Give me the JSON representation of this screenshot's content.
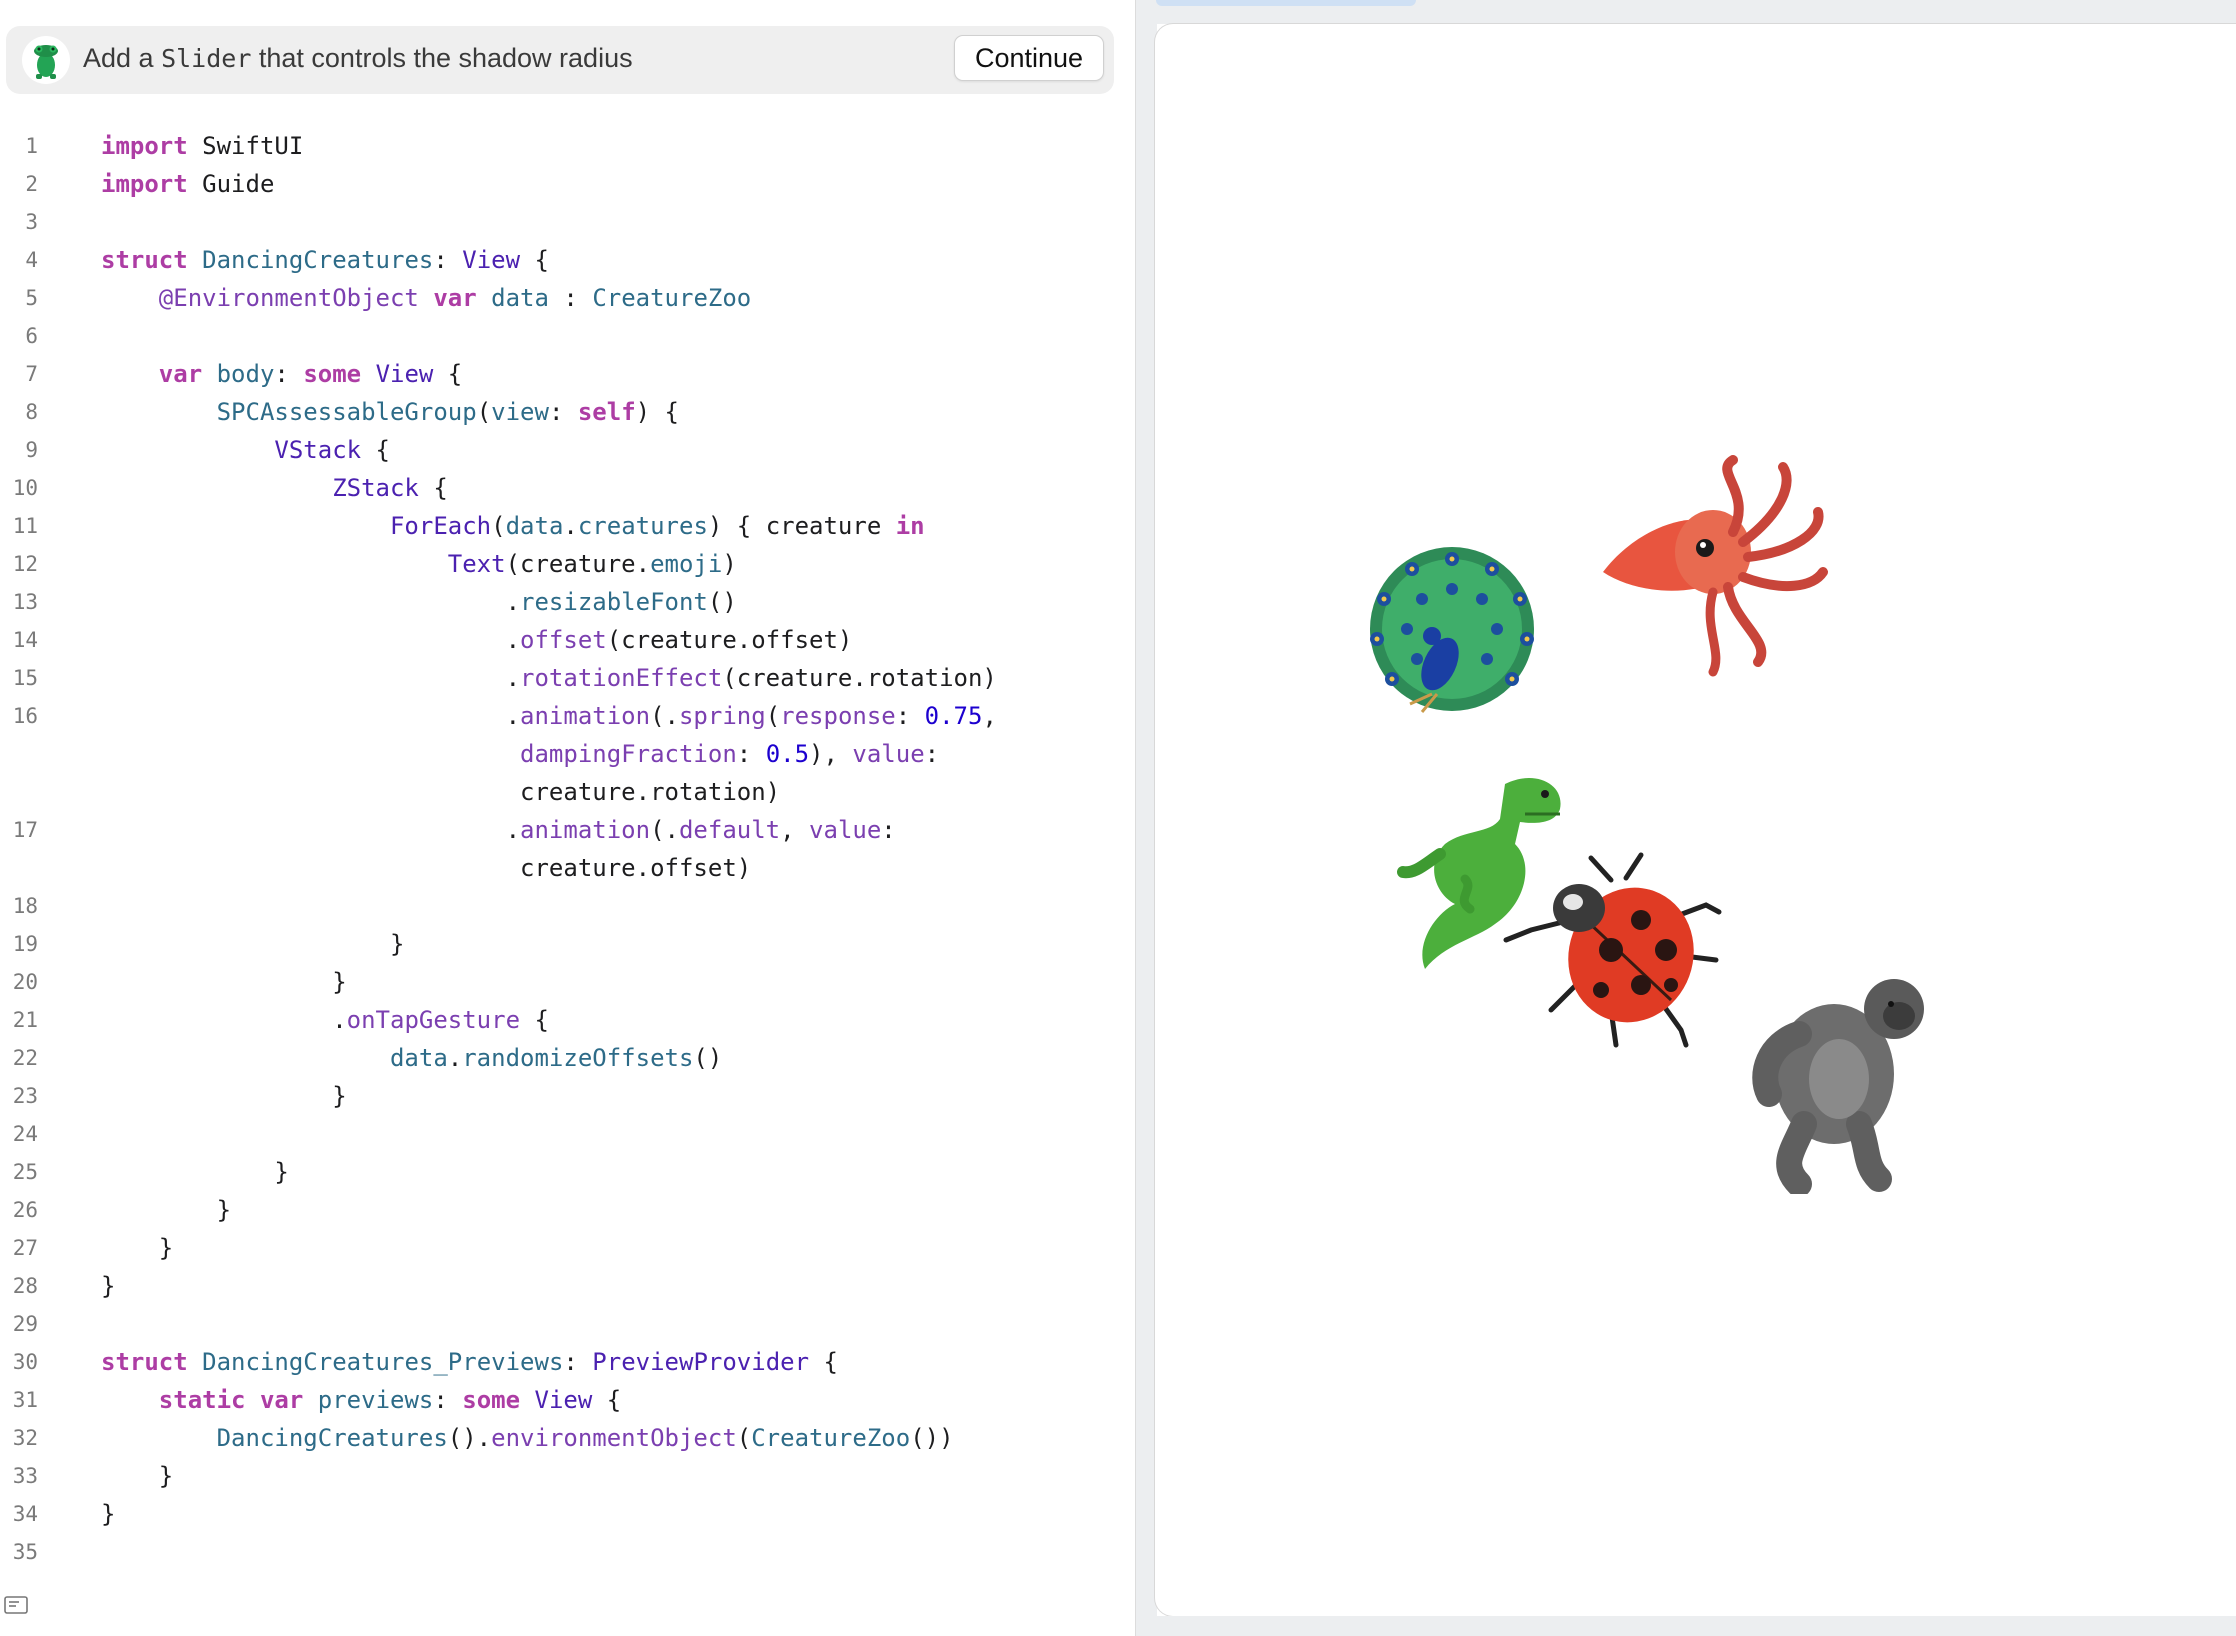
{
  "guide": {
    "avatar_icon": "guide-creature-icon",
    "message_prefix": "Add a ",
    "message_code": "Slider",
    "message_suffix": " that controls the shadow radius",
    "continue_label": "Continue"
  },
  "editor": {
    "lines": [
      {
        "n": "1",
        "html": "<span class='kw'>import</span> SwiftUI"
      },
      {
        "n": "2",
        "html": "<span class='kw'>import</span> Guide"
      },
      {
        "n": "3",
        "html": ""
      },
      {
        "n": "4",
        "html": "<span class='kw'>struct</span> <span class='pr'>DancingCreatures</span>: <span class='ty'>View</span> {"
      },
      {
        "n": "5",
        "html": "    <span class='at'>@EnvironmentObject</span> <span class='kw'>var</span> <span class='pr'>data</span> : <span class='pr'>CreatureZoo</span>"
      },
      {
        "n": "6",
        "html": ""
      },
      {
        "n": "7",
        "html": "    <span class='kw'>var</span> <span class='pr'>body</span>: <span class='kw'>some</span> <span class='ty'>View</span> {"
      },
      {
        "n": "8",
        "html": "        <span class='pr'>SPCAssessableGroup</span>(<span class='pr'>view</span>: <span class='kw'>self</span>) {"
      },
      {
        "n": "9",
        "html": "            <span class='ty'>VStack</span> {"
      },
      {
        "n": "10",
        "html": "                <span class='ty'>ZStack</span> {"
      },
      {
        "n": "11",
        "html": "                    <span class='ty'>ForEach</span>(<span class='pr'>data</span>.<span class='pr'>creatures</span>) { creature <span class='kw'>in</span>"
      },
      {
        "n": "12",
        "html": "                        <span class='ty'>Text</span>(creature.<span class='pr'>emoji</span>)"
      },
      {
        "n": "13",
        "html": "                            .<span class='pr'>resizableFont</span>()"
      },
      {
        "n": "14",
        "html": "                            .<span class='fn'>offset</span>(creature.offset)"
      },
      {
        "n": "15",
        "html": "                            .<span class='fn'>rotationEffect</span>(creature.rotation)"
      },
      {
        "n": "16",
        "html": "                            .<span class='fn'>animation</span>(.<span class='fn'>spring</span>(<span class='fn'>response</span>: <span class='nu'>0.75</span>,"
      },
      {
        "n": "",
        "html": "                             <span class='fn'>dampingFraction</span>: <span class='nu'>0.5</span>), <span class='fn'>value</span>:"
      },
      {
        "n": "",
        "html": "                             creature.rotation)"
      },
      {
        "n": "17",
        "html": "                            .<span class='fn'>animation</span>(.<span class='fn'>default</span>, <span class='fn'>value</span>:"
      },
      {
        "n": "",
        "html": "                             creature.offset)"
      },
      {
        "n": "18",
        "html": ""
      },
      {
        "n": "19",
        "html": "                    }"
      },
      {
        "n": "20",
        "html": "                }"
      },
      {
        "n": "21",
        "html": "                .<span class='fn'>onTapGesture</span> {"
      },
      {
        "n": "22",
        "html": "                    <span class='pr'>data</span>.<span class='pr'>randomizeOffsets</span>()"
      },
      {
        "n": "23",
        "html": "                }"
      },
      {
        "n": "24",
        "html": ""
      },
      {
        "n": "25",
        "html": "            }"
      },
      {
        "n": "26",
        "html": "        }"
      },
      {
        "n": "27",
        "html": "    }"
      },
      {
        "n": "28",
        "html": "}"
      },
      {
        "n": "29",
        "html": ""
      },
      {
        "n": "30",
        "html": "<span class='kw'>struct</span> <span class='pr'>DancingCreatures_Previews</span>: <span class='ty'>PreviewProvider</span> {"
      },
      {
        "n": "31",
        "html": "    <span class='kw'>static</span> <span class='kw'>var</span> <span class='pr'>previews</span>: <span class='kw'>some</span> <span class='ty'>View</span> {"
      },
      {
        "n": "32",
        "html": "        <span class='pr'>DancingCreatures</span>().<span class='fn'>environmentObject</span>(<span class='pr'>CreatureZoo</span>())"
      },
      {
        "n": "33",
        "html": "    }"
      },
      {
        "n": "34",
        "html": "}"
      },
      {
        "n": "35",
        "html": ""
      }
    ]
  },
  "preview": {
    "creatures": [
      {
        "name": "peacock-emoji"
      },
      {
        "name": "squid-emoji"
      },
      {
        "name": "t-rex-emoji"
      },
      {
        "name": "ladybug-emoji"
      },
      {
        "name": "gorilla-emoji"
      }
    ]
  },
  "colors": {
    "keyword": "#ad3da4",
    "type": "#4b21b0",
    "property": "#2d6b88",
    "number": "#1c00cf"
  }
}
